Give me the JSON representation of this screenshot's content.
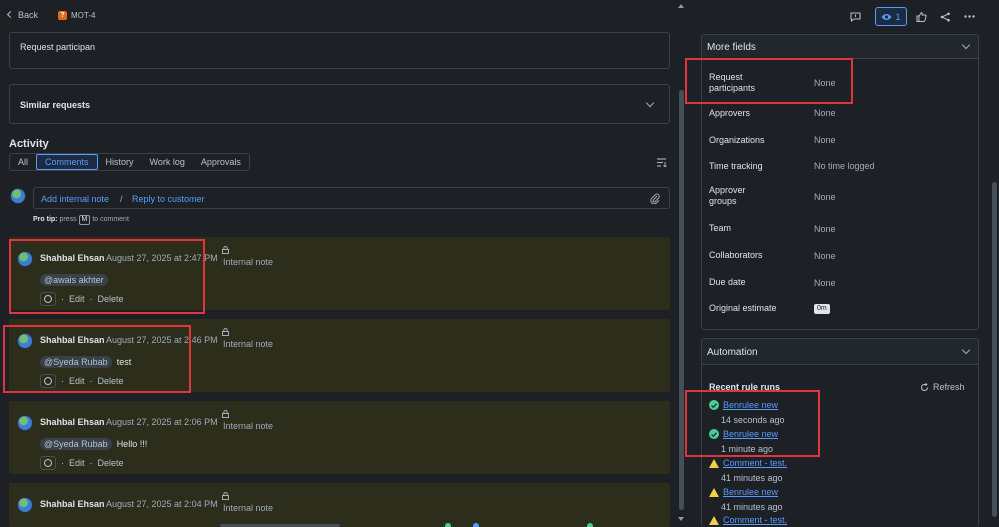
{
  "header": {
    "back_label": "Back",
    "issue_key": "MOT-4"
  },
  "field": {
    "value": "Request participan"
  },
  "similar": {
    "label": "Similar requests"
  },
  "activity": {
    "title": "Activity",
    "tabs": [
      "All",
      "Comments",
      "History",
      "Work log",
      "Approvals"
    ],
    "active_tab": "Comments",
    "add_internal_note": "Add internal note",
    "separator": "/",
    "reply_to_customer": "Reply to customer",
    "pro_tip_label": "Pro tip:",
    "pro_tip_press": "press",
    "pro_tip_key": "M",
    "pro_tip_suffix": "to comment"
  },
  "comments": [
    {
      "author": "Shahbal Ehsan",
      "date": "August 27, 2025 at 2:47 PM",
      "note": "Internal note",
      "mention": "@awais akhter",
      "text": "",
      "edit": "Edit",
      "delete": "Delete",
      "dot": "·"
    },
    {
      "author": "Shahbal Ehsan",
      "date": "August 27, 2025 at 2:46 PM",
      "note": "Internal note",
      "mention": "@Syeda Rubab",
      "text": "test",
      "edit": "Edit",
      "delete": "Delete",
      "dot": "·"
    },
    {
      "author": "Shahbal Ehsan",
      "date": "August 27, 2025 at 2:06 PM",
      "note": "Internal note",
      "mention": "@Syeda Rubab",
      "text": "Hello !!!",
      "edit": "Edit",
      "delete": "Delete",
      "dot": "·"
    },
    {
      "author": "Shahbal Ehsan",
      "date": "August 27, 2025 at 2:04 PM",
      "note": "Internal note"
    }
  ],
  "toolbar": {
    "watch_count": "1"
  },
  "more_fields": {
    "title": "More fields",
    "rows": [
      {
        "label": "Request participants",
        "value": "None"
      },
      {
        "label": "Approvers",
        "value": "None"
      },
      {
        "label": "Organizations",
        "value": "None"
      },
      {
        "label": "Time tracking",
        "value": "No time logged"
      },
      {
        "label": "Approver groups",
        "value": "None"
      },
      {
        "label": "Team",
        "value": "None"
      },
      {
        "label": "Collaborators",
        "value": "None"
      },
      {
        "label": "Due date",
        "value": "None"
      },
      {
        "label": "Original estimate",
        "value": "0m"
      }
    ]
  },
  "automation": {
    "title": "Automation",
    "recent_label": "Recent rule runs",
    "refresh_label": "Refresh",
    "runs": [
      {
        "name": "Benrulee new",
        "when": "14 seconds ago",
        "status": "success"
      },
      {
        "name": "Benrulee new",
        "when": "1 minute ago",
        "status": "success"
      },
      {
        "name": "Comment - test.",
        "when": "41 minutes ago",
        "status": "warning"
      },
      {
        "name": "Benrulee new",
        "when": "41 minutes ago",
        "status": "warning"
      },
      {
        "name": "Comment - test.",
        "when": "",
        "status": "warning"
      }
    ]
  },
  "colors": {
    "highlight": "#e2343d",
    "link": "#579dff",
    "success": "#4bce97",
    "warning": "#f5cd47",
    "internal_note_bg": "#2c2d1b"
  }
}
